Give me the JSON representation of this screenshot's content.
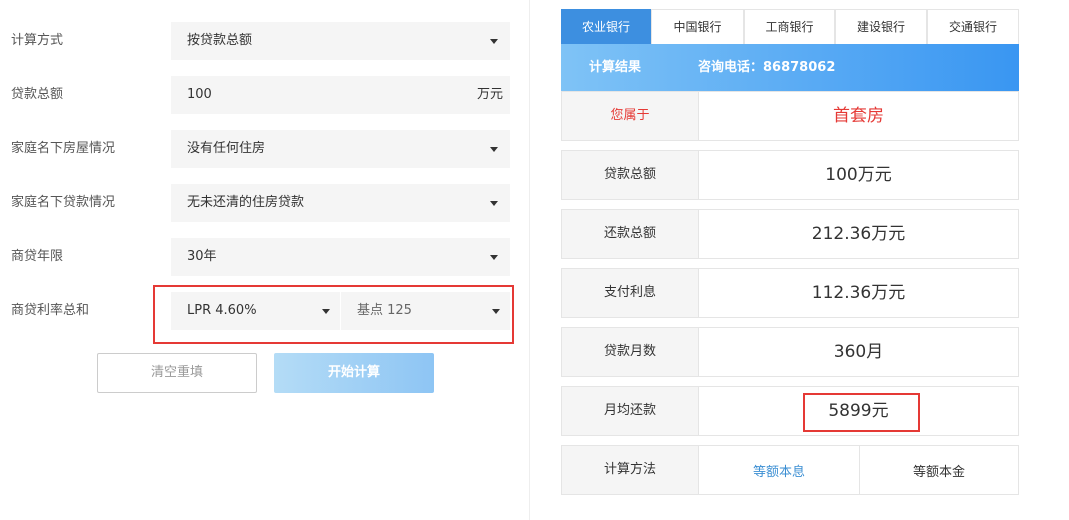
{
  "form": {
    "calc_method": {
      "label": "计算方式",
      "value": "按贷款总额"
    },
    "loan_total": {
      "label": "贷款总额",
      "value": "100",
      "unit": "万元"
    },
    "house_status": {
      "label": "家庭名下房屋情况",
      "value": "没有任何住房"
    },
    "loan_status": {
      "label": "家庭名下贷款情况",
      "value": "无未还清的住房贷款"
    },
    "loan_years": {
      "label": "商贷年限",
      "value": "30年"
    },
    "rate": {
      "label": "商贷利率总和",
      "lpr_value": "LPR 4.60%",
      "basis_value": "基点 125"
    },
    "clear_button": "清空重填",
    "start_button": "开始计算"
  },
  "bank_tabs": [
    "农业银行",
    "中国银行",
    "工商银行",
    "建设银行",
    "交通银行"
  ],
  "active_tab": "农业银行",
  "result": {
    "title": "计算结果",
    "phone": "咨询电话：86878062",
    "rows": [
      {
        "label": "您属于",
        "value": "首套房"
      },
      {
        "label": "贷款总额",
        "value": "100万元"
      },
      {
        "label": "还款总额",
        "value": "212.36万元"
      },
      {
        "label": "支付利息",
        "value": "112.36万元"
      },
      {
        "label": "贷款月数",
        "value": "360月"
      },
      {
        "label": "月均还款",
        "value": "5899元"
      }
    ],
    "method_label": "计算方法",
    "methods": [
      "等额本息",
      "等额本金"
    ]
  },
  "colors": {
    "accent_blue": "#3d8fe0",
    "highlight_red": "#e53935",
    "link_blue": "#3c8fd3"
  }
}
